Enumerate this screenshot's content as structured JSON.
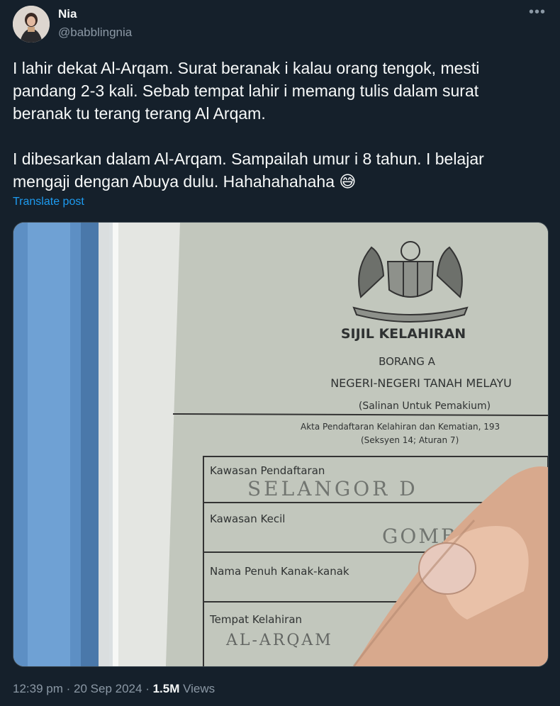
{
  "author": {
    "name": "Nia",
    "handle": "@babblingnia"
  },
  "menu_icon": "more-dots-icon",
  "tweet": {
    "text": "I lahir dekat Al-Arqam. Surat beranak i kalau orang tengok, mesti pandang 2-3 kali. Sebab tempat lahir i memang tulis dalam surat beranak tu terang terang Al Arqam.\n\nI dibesarkan dalam Al-Arqam. Sampailah umur i 8 tahun. I belajar mengaji dengan Abuya dulu. Hahahahahaha 😅",
    "translate_label": "Translate post"
  },
  "photo": {
    "title": "SIJIL KELAHIRAN",
    "form": "BORANG A",
    "state": "NEGERI-NEGERI TANAH MELAYU",
    "copy": "(Salinan Untuk Pemakium)",
    "act": "Akta Pendaftaran Kelahiran dan Kematian, 193",
    "section": "(Seksyen 14; Aturan 7)",
    "fields": {
      "registration_area_label": "Kawasan Pendaftaran",
      "registration_area_value": "SELANGOR D",
      "sub_area_label": "Kawasan Kecil",
      "sub_area_value": "GOMBAK",
      "child_name_label": "Nama Penuh Kanak-kanak",
      "birthplace_label": "Tempat Kelahiran",
      "birthplace_value": "AL-ARQAM"
    }
  },
  "footer": {
    "time": "12:39 pm",
    "separator": "·",
    "date": "20 Sep 2024",
    "views_count": "1.5M",
    "views_label": "Views"
  },
  "colors": {
    "background": "#15202b",
    "text": "#f7f9f9",
    "secondary": "#8b98a5",
    "link": "#1d9bf0"
  }
}
